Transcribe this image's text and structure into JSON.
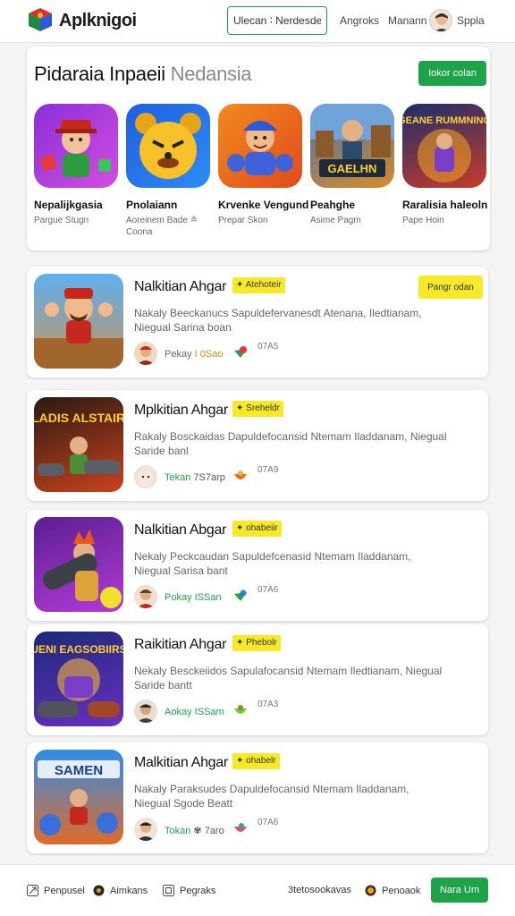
{
  "header": {
    "brand": "Aplknigoi",
    "search_placeholder": "Ulecan ∶ Nerdesdev",
    "nav": [
      "Angroks",
      "Manann",
      "Sppla"
    ]
  },
  "featured": {
    "title": "Pidaraia Inpaeii",
    "subtitle": "Nedansia",
    "button": "Iokor colan",
    "tiles": [
      {
        "name": "Nepalijkgasia",
        "sub": "Pargue Stugn"
      },
      {
        "name": "Pnolaiann",
        "sub": "Aoreinem Bade ≗ Coona"
      },
      {
        "name": "Krvenke Vengund",
        "sub": "Prepar Skon"
      },
      {
        "name": "Peahghe",
        "sub": "Asime Pagm"
      },
      {
        "name": "Raralisia haleoln",
        "sub": "Pape Hoin"
      }
    ]
  },
  "cards": [
    {
      "title": "Nalkitian Ahgar",
      "badge": "✦ Atehoteir",
      "desc": "Nakaly Beeckanucs Sapuldefervanesdt Atenana, Iledtianam, Niegual Sarina boan",
      "rating1": "Pekay",
      "rating2": "I 0Sao",
      "num": "07A5",
      "button": "Pangr odan"
    },
    {
      "title": "Mplkitian Ahgar",
      "badge": "✦ Sreheldr",
      "desc": "Rakaly Bosckaidas Dapuldefocansid Ntemam Iladdanam, Niegual Saride banl",
      "rating1": "Tekan",
      "rating2": "7S7arp",
      "num": "07A9"
    },
    {
      "title": "Nalkitian Abgar",
      "badge": "✦ ohabeiir",
      "desc": "Nekaly Peckcaudan Sapuldefcenasid Ntemam Iladdanam, Niegual Sarisa bant",
      "rating1": "Pokay",
      "rating2": "ISSan",
      "num": "07A6"
    },
    {
      "title": "Raikitian Ahgar",
      "badge": "✦ Phebolr",
      "desc": "Nekaly Besckeiidos Sapulafocansid Ntemam Iledtianam, Niegual Saride bantt",
      "rating1": "Aokay",
      "rating2": "ISSam",
      "num": "07A3"
    },
    {
      "title": "Malkitian Ahgar",
      "badge": "✦ ohabelr",
      "desc": "Nakaly Paraksudes Dapuldefocansid Ntemam Iladdanam, Niegual Sgode Beatt",
      "rating1": "Tokan",
      "rating2": "✾ 7aro",
      "num": "07A6"
    }
  ],
  "tile_art_labels": [
    "GEANE RUMMNING",
    "GAELHN"
  ],
  "card_art_labels": [
    "",
    "ELADIS ALSTAIRN",
    "",
    "UENI EAGSOBIIRS",
    "SAMEN"
  ],
  "footer": {
    "items": [
      "Penpusel",
      "Aimkans",
      "Pegraks",
      "3tetosookavas",
      "Penoaok"
    ],
    "button": "Nara Um"
  },
  "colors": {
    "accent_green": "#1fa34a",
    "badge_yellow": "#f8e928",
    "search_border": "#1e9e4c"
  }
}
